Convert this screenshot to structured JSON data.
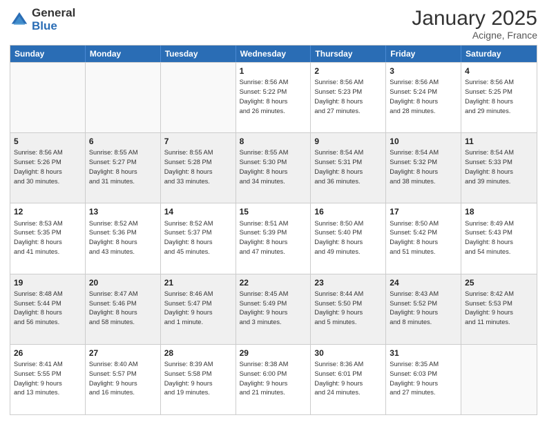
{
  "logo": {
    "general": "General",
    "blue": "Blue"
  },
  "title": "January 2025",
  "subtitle": "Acigne, France",
  "days": [
    "Sunday",
    "Monday",
    "Tuesday",
    "Wednesday",
    "Thursday",
    "Friday",
    "Saturday"
  ],
  "rows": [
    [
      {
        "day": "",
        "text": "",
        "empty": true
      },
      {
        "day": "",
        "text": "",
        "empty": true
      },
      {
        "day": "",
        "text": "",
        "empty": true
      },
      {
        "day": "1",
        "text": "Sunrise: 8:56 AM\nSunset: 5:22 PM\nDaylight: 8 hours\nand 26 minutes."
      },
      {
        "day": "2",
        "text": "Sunrise: 8:56 AM\nSunset: 5:23 PM\nDaylight: 8 hours\nand 27 minutes."
      },
      {
        "day": "3",
        "text": "Sunrise: 8:56 AM\nSunset: 5:24 PM\nDaylight: 8 hours\nand 28 minutes."
      },
      {
        "day": "4",
        "text": "Sunrise: 8:56 AM\nSunset: 5:25 PM\nDaylight: 8 hours\nand 29 minutes."
      }
    ],
    [
      {
        "day": "5",
        "text": "Sunrise: 8:56 AM\nSunset: 5:26 PM\nDaylight: 8 hours\nand 30 minutes."
      },
      {
        "day": "6",
        "text": "Sunrise: 8:55 AM\nSunset: 5:27 PM\nDaylight: 8 hours\nand 31 minutes."
      },
      {
        "day": "7",
        "text": "Sunrise: 8:55 AM\nSunset: 5:28 PM\nDaylight: 8 hours\nand 33 minutes."
      },
      {
        "day": "8",
        "text": "Sunrise: 8:55 AM\nSunset: 5:30 PM\nDaylight: 8 hours\nand 34 minutes."
      },
      {
        "day": "9",
        "text": "Sunrise: 8:54 AM\nSunset: 5:31 PM\nDaylight: 8 hours\nand 36 minutes."
      },
      {
        "day": "10",
        "text": "Sunrise: 8:54 AM\nSunset: 5:32 PM\nDaylight: 8 hours\nand 38 minutes."
      },
      {
        "day": "11",
        "text": "Sunrise: 8:54 AM\nSunset: 5:33 PM\nDaylight: 8 hours\nand 39 minutes."
      }
    ],
    [
      {
        "day": "12",
        "text": "Sunrise: 8:53 AM\nSunset: 5:35 PM\nDaylight: 8 hours\nand 41 minutes."
      },
      {
        "day": "13",
        "text": "Sunrise: 8:52 AM\nSunset: 5:36 PM\nDaylight: 8 hours\nand 43 minutes."
      },
      {
        "day": "14",
        "text": "Sunrise: 8:52 AM\nSunset: 5:37 PM\nDaylight: 8 hours\nand 45 minutes."
      },
      {
        "day": "15",
        "text": "Sunrise: 8:51 AM\nSunset: 5:39 PM\nDaylight: 8 hours\nand 47 minutes."
      },
      {
        "day": "16",
        "text": "Sunrise: 8:50 AM\nSunset: 5:40 PM\nDaylight: 8 hours\nand 49 minutes."
      },
      {
        "day": "17",
        "text": "Sunrise: 8:50 AM\nSunset: 5:42 PM\nDaylight: 8 hours\nand 51 minutes."
      },
      {
        "day": "18",
        "text": "Sunrise: 8:49 AM\nSunset: 5:43 PM\nDaylight: 8 hours\nand 54 minutes."
      }
    ],
    [
      {
        "day": "19",
        "text": "Sunrise: 8:48 AM\nSunset: 5:44 PM\nDaylight: 8 hours\nand 56 minutes."
      },
      {
        "day": "20",
        "text": "Sunrise: 8:47 AM\nSunset: 5:46 PM\nDaylight: 8 hours\nand 58 minutes."
      },
      {
        "day": "21",
        "text": "Sunrise: 8:46 AM\nSunset: 5:47 PM\nDaylight: 9 hours\nand 1 minute."
      },
      {
        "day": "22",
        "text": "Sunrise: 8:45 AM\nSunset: 5:49 PM\nDaylight: 9 hours\nand 3 minutes."
      },
      {
        "day": "23",
        "text": "Sunrise: 8:44 AM\nSunset: 5:50 PM\nDaylight: 9 hours\nand 5 minutes."
      },
      {
        "day": "24",
        "text": "Sunrise: 8:43 AM\nSunset: 5:52 PM\nDaylight: 9 hours\nand 8 minutes."
      },
      {
        "day": "25",
        "text": "Sunrise: 8:42 AM\nSunset: 5:53 PM\nDaylight: 9 hours\nand 11 minutes."
      }
    ],
    [
      {
        "day": "26",
        "text": "Sunrise: 8:41 AM\nSunset: 5:55 PM\nDaylight: 9 hours\nand 13 minutes."
      },
      {
        "day": "27",
        "text": "Sunrise: 8:40 AM\nSunset: 5:57 PM\nDaylight: 9 hours\nand 16 minutes."
      },
      {
        "day": "28",
        "text": "Sunrise: 8:39 AM\nSunset: 5:58 PM\nDaylight: 9 hours\nand 19 minutes."
      },
      {
        "day": "29",
        "text": "Sunrise: 8:38 AM\nSunset: 6:00 PM\nDaylight: 9 hours\nand 21 minutes."
      },
      {
        "day": "30",
        "text": "Sunrise: 8:36 AM\nSunset: 6:01 PM\nDaylight: 9 hours\nand 24 minutes."
      },
      {
        "day": "31",
        "text": "Sunrise: 8:35 AM\nSunset: 6:03 PM\nDaylight: 9 hours\nand 27 minutes."
      },
      {
        "day": "",
        "text": "",
        "empty": true
      }
    ]
  ]
}
